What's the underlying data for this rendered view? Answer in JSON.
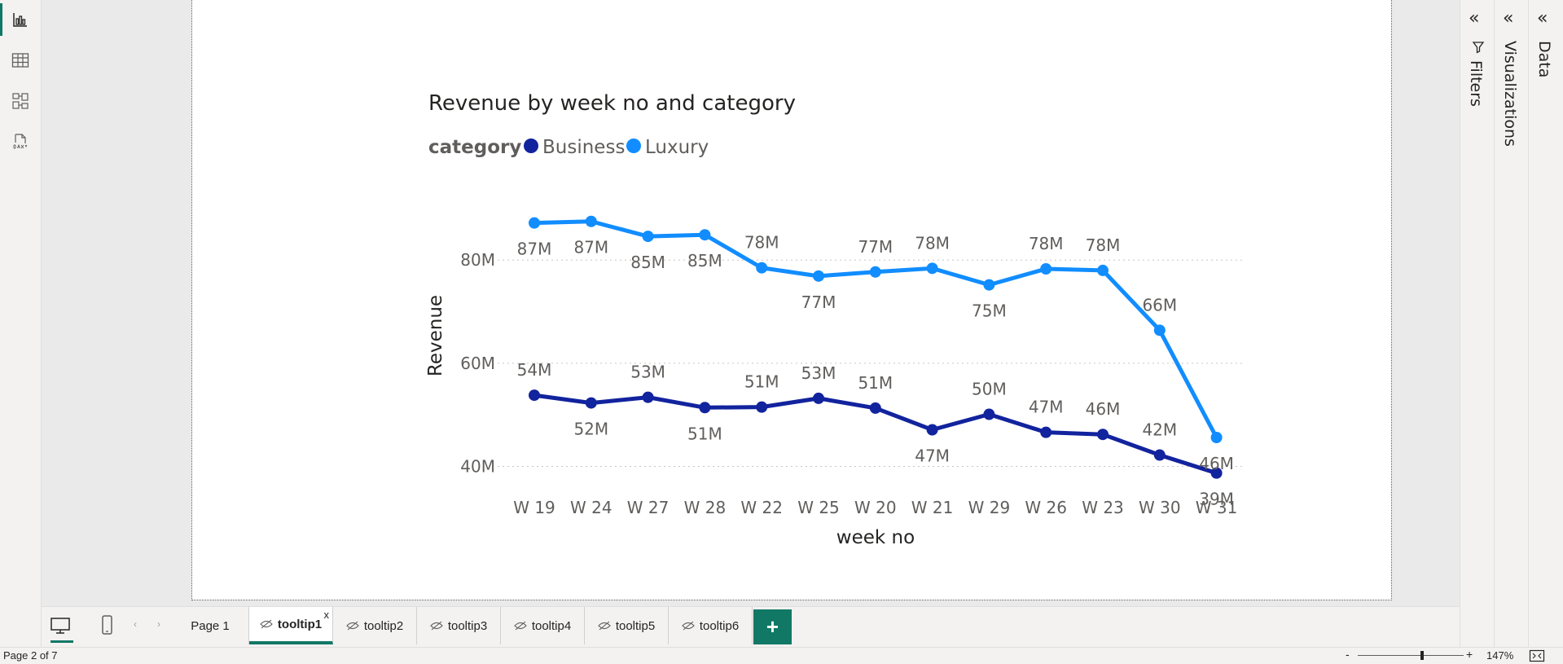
{
  "leftbar": {
    "items": [
      {
        "name": "report-view-icon"
      },
      {
        "name": "table-view-icon"
      },
      {
        "name": "model-view-icon"
      },
      {
        "name": "dax-query-icon"
      }
    ]
  },
  "chart_data": {
    "type": "line",
    "title": "Revenue by week no and category",
    "legend_title": "category",
    "legend_placement": "top-left",
    "xlabel": "week no",
    "ylabel": "Revenue",
    "categories": [
      "W 19",
      "W 24",
      "W 27",
      "W 28",
      "W 22",
      "W 25",
      "W 20",
      "W 21",
      "W 29",
      "W 26",
      "W 23",
      "W 30",
      "W 31"
    ],
    "y_ticks": [
      40,
      60,
      80
    ],
    "y_tick_labels": [
      "40M",
      "60M",
      "80M"
    ],
    "ylim": [
      32,
      94
    ],
    "unit": "M",
    "grid": true,
    "series": [
      {
        "name": "Business",
        "color": "#12239e",
        "values": [
          53.8,
          52.3,
          53.4,
          51.4,
          51.5,
          53.2,
          51.3,
          47.1,
          50.1,
          46.6,
          46.2,
          42.2,
          38.7
        ],
        "labels": [
          "54M",
          "52M",
          "53M",
          "51M",
          "51M",
          "53M",
          "51M",
          "47M",
          "50M",
          "47M",
          "46M",
          "42M",
          "39M"
        ],
        "label_pos": [
          "above",
          "below",
          "above",
          "below",
          "above",
          "above",
          "above",
          "below",
          "above",
          "above",
          "above",
          "above",
          "below"
        ]
      },
      {
        "name": "Luxury",
        "color": "#118dff",
        "values": [
          87.2,
          87.5,
          84.6,
          84.9,
          78.5,
          76.9,
          77.7,
          78.4,
          75.2,
          78.3,
          78.0,
          66.4,
          45.6
        ],
        "labels": [
          "87M",
          "87M",
          "85M",
          "85M",
          "78M",
          "77M",
          "77M",
          "78M",
          "75M",
          "78M",
          "78M",
          "66M",
          "46M"
        ],
        "label_pos": [
          "below",
          "below",
          "below",
          "below",
          "above",
          "below",
          "above",
          "above",
          "below",
          "above",
          "above",
          "above",
          "below"
        ]
      }
    ]
  },
  "panes": {
    "filters": "Filters",
    "visualizations": "Visualizations",
    "data": "Data"
  },
  "tabs": [
    {
      "label": "Page 1",
      "hidden": false,
      "active": false
    },
    {
      "label": "tooltip1",
      "hidden": true,
      "active": true
    },
    {
      "label": "tooltip2",
      "hidden": true,
      "active": false
    },
    {
      "label": "tooltip3",
      "hidden": true,
      "active": false
    },
    {
      "label": "tooltip4",
      "hidden": true,
      "active": false
    },
    {
      "label": "tooltip5",
      "hidden": true,
      "active": false
    },
    {
      "label": "tooltip6",
      "hidden": true,
      "active": false
    }
  ],
  "tab_close": "x",
  "add_page": "+",
  "status": {
    "page_indicator": "Page 2 of 7",
    "zoom_minus": "-",
    "zoom_plus": "+",
    "zoom_level": "147%",
    "zoom_fraction": 0.61
  },
  "colors": {
    "accent": "#117865",
    "business": "#12239e",
    "luxury": "#118dff"
  }
}
